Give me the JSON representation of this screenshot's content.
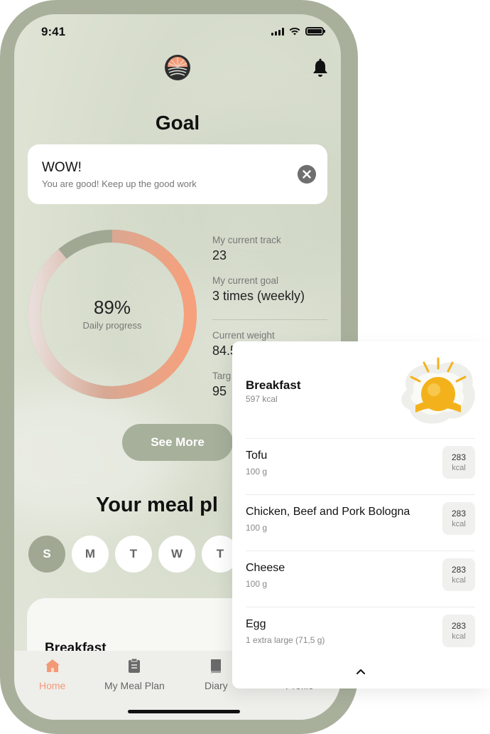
{
  "status": {
    "time": "9:41"
  },
  "goal": {
    "title": "Goal",
    "banner": {
      "title": "WOW!",
      "message": "You are good! Keep up the good work"
    },
    "progress": {
      "percent_label": "89%",
      "percent": 0.89,
      "label": "Daily progress"
    },
    "stats": [
      {
        "label": "My current track",
        "value": "23"
      },
      {
        "label": "My current goal",
        "value": "3 times (weekly)"
      },
      {
        "label": "Current weight",
        "value": "84.5"
      },
      {
        "label": "Targ",
        "value": "95"
      }
    ],
    "see_more_label": "See More"
  },
  "meal_plan": {
    "title": "Your meal pl",
    "days": [
      "S",
      "M",
      "T",
      "W",
      "T"
    ],
    "active_day_index": 0,
    "card_title": "Breakfast"
  },
  "tabs": [
    {
      "label": "Home",
      "icon": "home-icon",
      "active": true
    },
    {
      "label": "My Meal Plan",
      "icon": "clipboard-icon",
      "active": false
    },
    {
      "label": "Diary",
      "icon": "book-icon",
      "active": false
    },
    {
      "label": "Profile",
      "icon": "profile-icon",
      "active": false
    }
  ],
  "panel": {
    "title": "Breakfast",
    "kcal": "597 kcal",
    "items": [
      {
        "name": "Tofu",
        "qty": "100 g",
        "kcal": "283",
        "unit": "kcal"
      },
      {
        "name": "Chicken, Beef and Pork Bologna",
        "qty": "100 g",
        "kcal": "283",
        "unit": "kcal"
      },
      {
        "name": "Cheese",
        "qty": "100 g",
        "kcal": "283",
        "unit": "kcal"
      },
      {
        "name": "Egg",
        "qty": "1 extra large (71,5 g)",
        "kcal": "283",
        "unit": "kcal"
      }
    ]
  },
  "colors": {
    "accent": "#f29a78",
    "sage": "#a7b09b",
    "ring_start": "#e8ddd9",
    "ring_end": "#f7a07c",
    "ring_track": "#a0a894"
  }
}
